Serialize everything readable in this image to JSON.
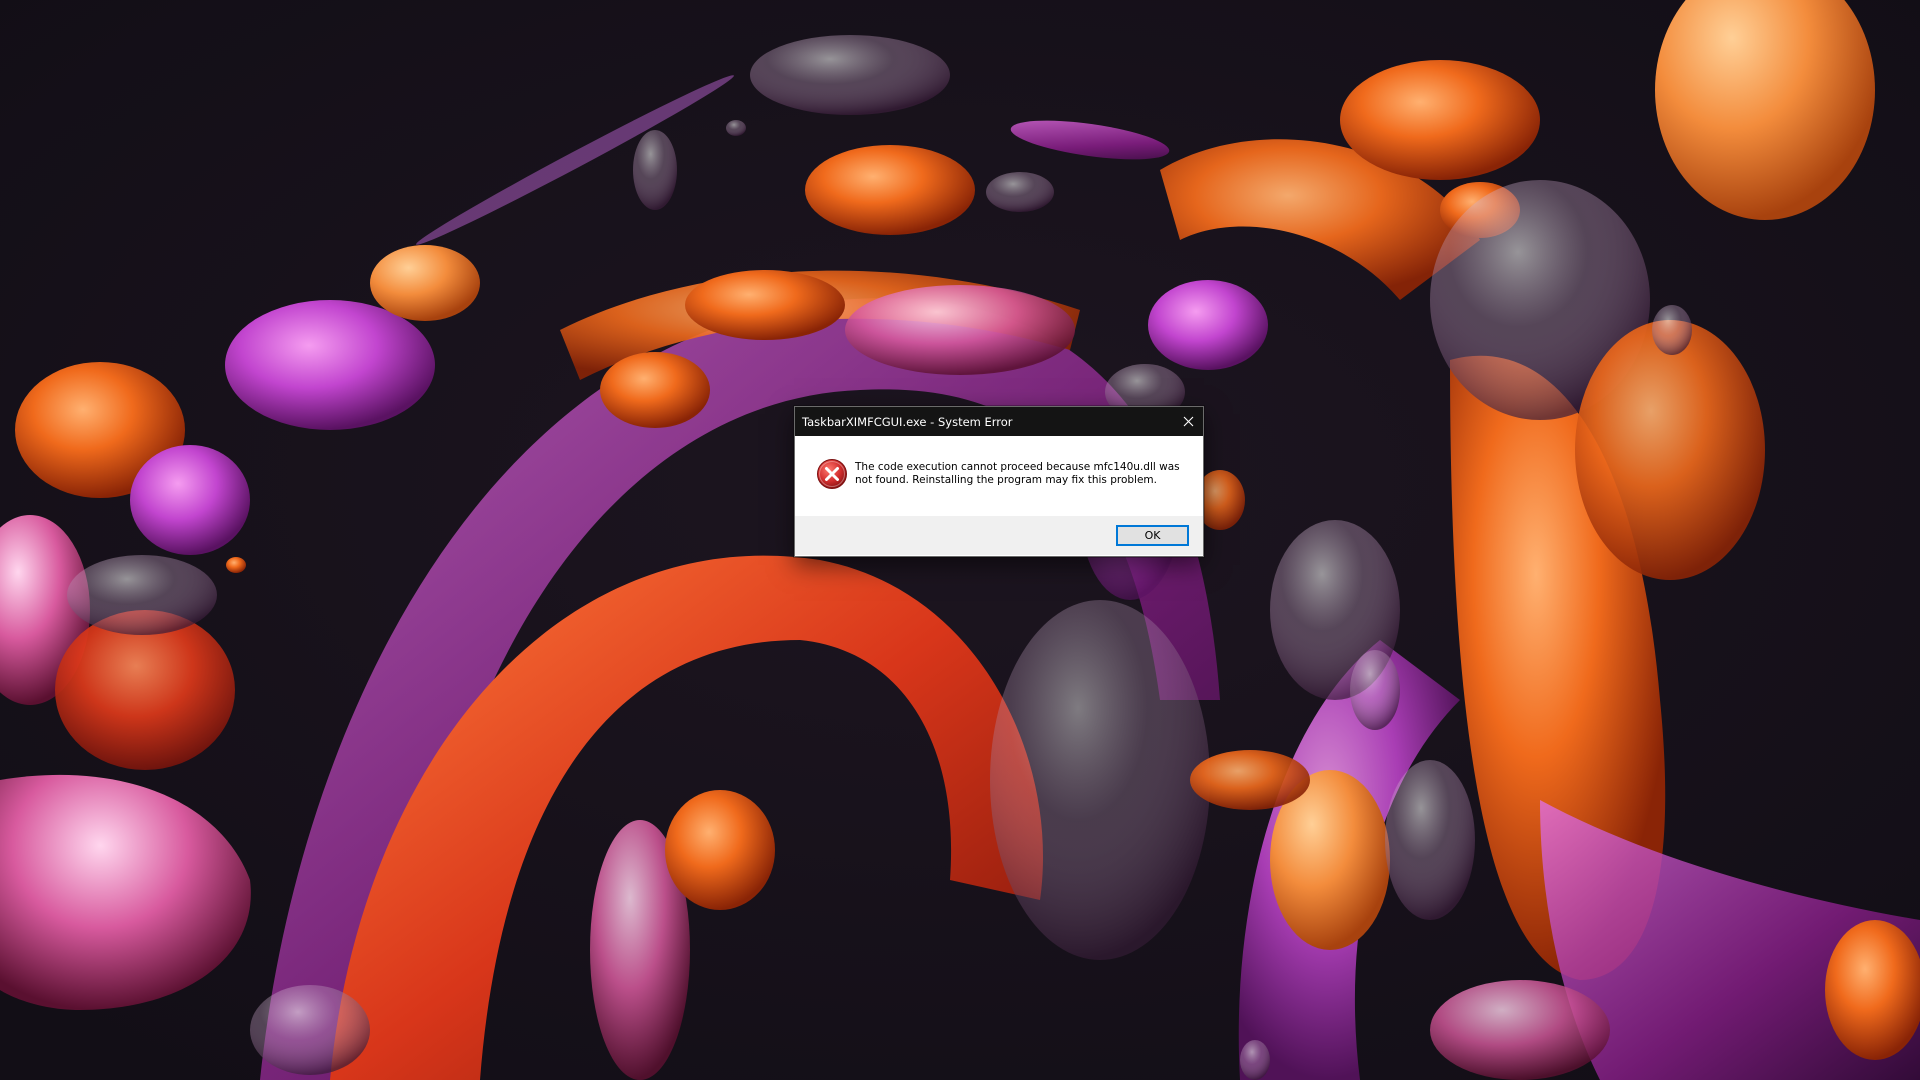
{
  "desktop": {
    "wallpaper": "abstract-glass-blobs",
    "colors": {
      "background": "#15101a",
      "orange": "#e8601a",
      "magenta": "#b23fc0",
      "red": "#d93a20"
    }
  },
  "dialog": {
    "title": "TaskbarXIMFCGUI.exe - System Error",
    "icon": "error-icon",
    "message": "The code execution cannot proceed because mfc140u.dll was not found. Reinstalling the program may fix this problem.",
    "ok_label": "OK",
    "close_icon": "close-icon",
    "colors": {
      "titlebar": "#141414",
      "footer": "#f0f0f0",
      "button_border": "#0078d7",
      "error_red": "#d32f2f"
    }
  }
}
